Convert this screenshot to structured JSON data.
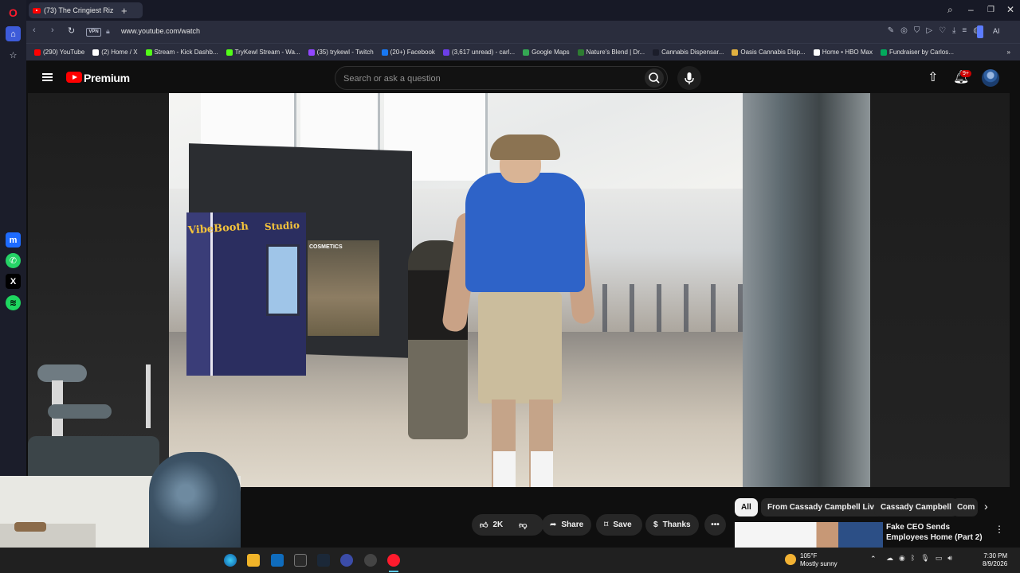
{
  "browser": {
    "tab_title": "(73) The Cringiest Riz",
    "url": "www.youtube.com/watch",
    "vpn_label": "VPN",
    "ai_label": "AI",
    "bookmarks": [
      {
        "label": "(290) YouTube",
        "color": "#ff0000"
      },
      {
        "label": "(2) Home / X",
        "color": "#ffffff"
      },
      {
        "label": "Stream - Kick Dashb...",
        "color": "#53fc18"
      },
      {
        "label": "TryKewl Stream - Wa...",
        "color": "#53fc18"
      },
      {
        "label": "(35) trykewl - Twitch",
        "color": "#9146ff"
      },
      {
        "label": "(20+) Facebook",
        "color": "#1877f2"
      },
      {
        "label": "(3,617 unread) - carl...",
        "color": "#6c3ee8"
      },
      {
        "label": "Google Maps",
        "color": "#34a853"
      },
      {
        "label": "Nature's Blend | Dr...",
        "color": "#2e7d32"
      },
      {
        "label": "Cannabis Dispensar...",
        "color": "#1b1d2a"
      },
      {
        "label": "Oasis Cannabis Disp...",
        "color": "#e0b040"
      },
      {
        "label": "Home • HBO Max",
        "color": "#ffffff"
      },
      {
        "label": "Fundraiser by Carlos...",
        "color": "#02a95c"
      }
    ]
  },
  "youtube": {
    "brand": "Premium",
    "search_placeholder": "Search or ask a question",
    "notifications_badge": "9+",
    "actions": {
      "like_count": "2K",
      "share_label": "Share",
      "save_label": "Save",
      "thanks_label": "Thanks"
    },
    "chips": [
      "All",
      "From Cassady Campbell Live",
      "Cassady Campbell",
      "Com"
    ],
    "recommendation": {
      "title": "Fake CEO Sends Employees Home (Part 2)"
    }
  },
  "video_scene": {
    "sign_1": "VibeBooth",
    "sign_2": "Studio",
    "store_sign": "COSMETICS"
  },
  "taskbar": {
    "weather_temp": "105°F",
    "weather_desc": "Mostly sunny",
    "time": "7:30 PM",
    "date": "8/9/2026"
  }
}
